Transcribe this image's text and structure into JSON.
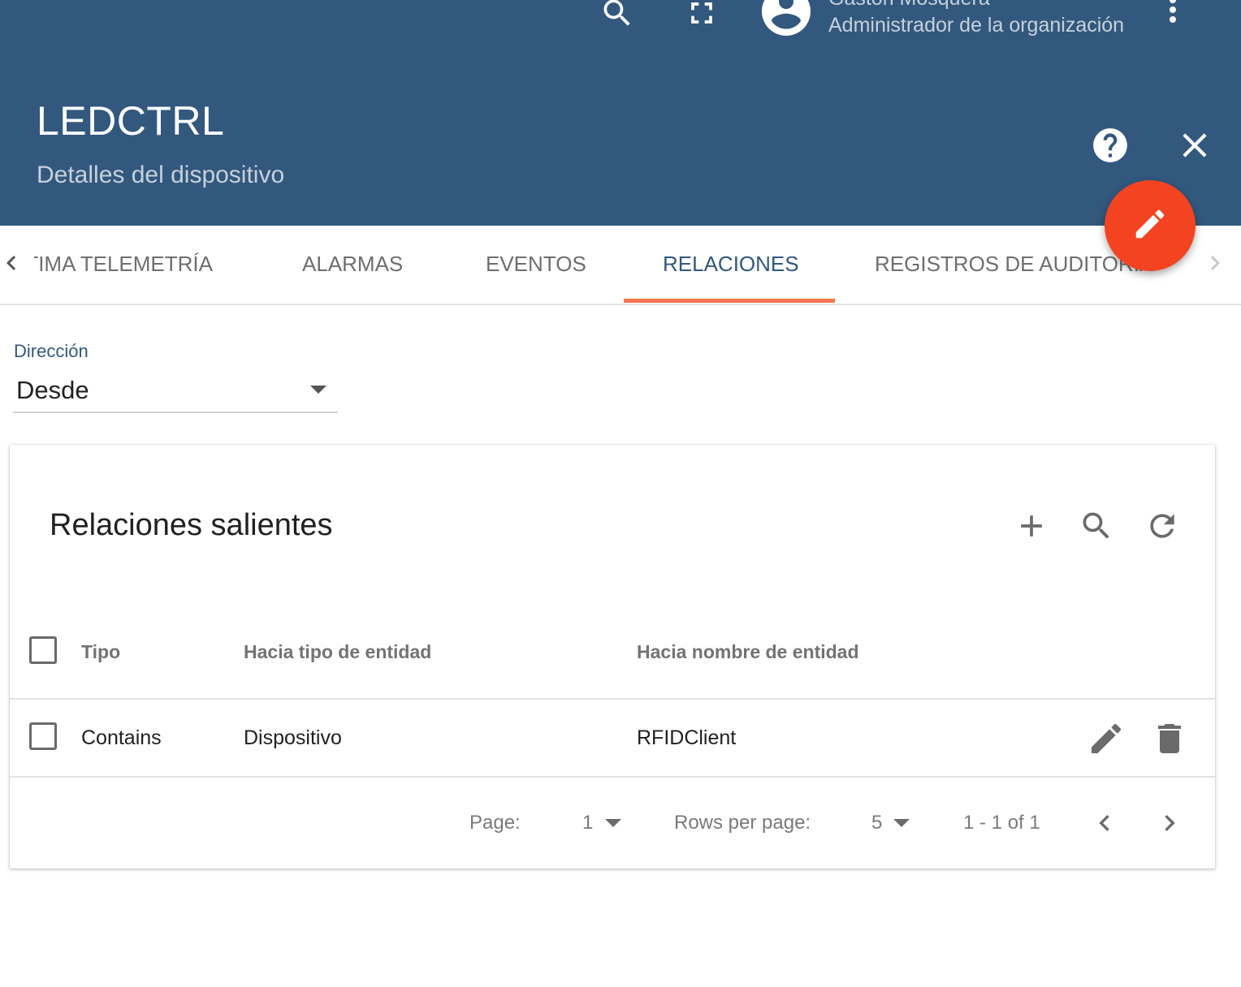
{
  "header": {
    "user_name": "Gaston Mosquera",
    "user_role": "Administrador de la organización",
    "title": "LEDCTRL",
    "subtitle": "Detalles del dispositivo"
  },
  "tabs": [
    {
      "label": "ÚLTIMA TELEMETRÍA",
      "active": false
    },
    {
      "label": "ALARMAS",
      "active": false
    },
    {
      "label": "EVENTOS",
      "active": false
    },
    {
      "label": "RELACIONES",
      "active": true
    },
    {
      "label": "REGISTROS DE AUDITORÍA",
      "active": false
    }
  ],
  "direction": {
    "label": "Dirección",
    "value": "Desde"
  },
  "card": {
    "title": "Relaciones salientes",
    "columns": [
      "Tipo",
      "Hacia tipo de entidad",
      "Hacia nombre de entidad"
    ],
    "rows": [
      {
        "tipo": "Contains",
        "tipo_entidad": "Dispositivo",
        "nombre_entidad": "RFIDClient"
      }
    ],
    "pagination": {
      "page_label": "Page:",
      "page_value": "1",
      "rows_label": "Rows per page:",
      "rows_value": "5",
      "range": "1 - 1 of 1"
    }
  },
  "icons": {
    "header": [
      "search-icon",
      "fullscreen-icon",
      "account-icon",
      "more-vert-icon",
      "help-icon",
      "close-icon",
      "edit-icon"
    ],
    "card": [
      "add-icon",
      "search-icon",
      "refresh-icon",
      "edit-icon",
      "delete-icon",
      "chevron-left-icon",
      "chevron-right-icon"
    ]
  },
  "colors": {
    "header_bg": "#32587e",
    "accent": "#f4754e",
    "fab": "#f44321",
    "active_tab": "#32587e"
  }
}
